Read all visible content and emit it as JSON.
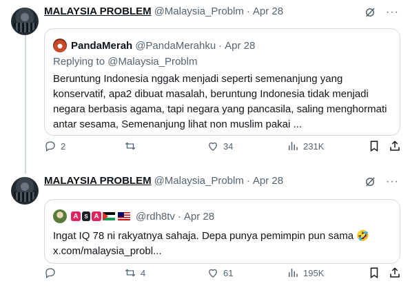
{
  "tweets": [
    {
      "author": "MALAYSIA PROBLEM",
      "handle": "@Malaysia_Problm",
      "date_sep": "·",
      "date": "Apr 28",
      "quote": {
        "name": "PandaMerah",
        "handle": "@PandaMerahku",
        "date_sep": "·",
        "date": "Apr 28",
        "replying_to": "Replying to @Malaysia_Problm",
        "body": "Beruntung Indonesia nggak menjadi seperti semenanjung yang konservatif, apa2 dibuat masalah, beruntung Indonesia tidak menjadi negara berbasis agama, tapi negara yang pancasila, saling menghormati antar sesama, Semenanjung lihat non muslim pakai ..."
      },
      "actions": {
        "replies": "2",
        "retweets": "",
        "likes": "34",
        "views": "231K"
      }
    },
    {
      "author": "MALAYSIA PROBLEM",
      "handle": "@Malaysia_Problm",
      "date_sep": "·",
      "date": "Apr 28",
      "quote": {
        "badge_a1": "A",
        "badge_mid": "S",
        "badge_a2": "A",
        "handle": "@rdh8tv",
        "date_sep": "·",
        "date": "Apr 28",
        "body_line1": "Ingat IQ 78 ni rakyatnya sahaja. Depa punya pemimpin pun sama 🤣",
        "body_line2": "x.com/malaysia_probl..."
      },
      "actions": {
        "replies": "",
        "retweets": "4",
        "likes": "61",
        "views": "195K"
      }
    }
  ],
  "icons": {
    "more": "more-icon",
    "grok": "grok-icon",
    "reply": "reply-icon",
    "retweet": "retweet-icon",
    "like": "heart-icon",
    "views": "views-icon",
    "bookmark": "bookmark-icon",
    "share": "share-icon"
  },
  "colors": {
    "text": "#0f1419",
    "secondary": "#536471",
    "border": "#cfd9de"
  }
}
